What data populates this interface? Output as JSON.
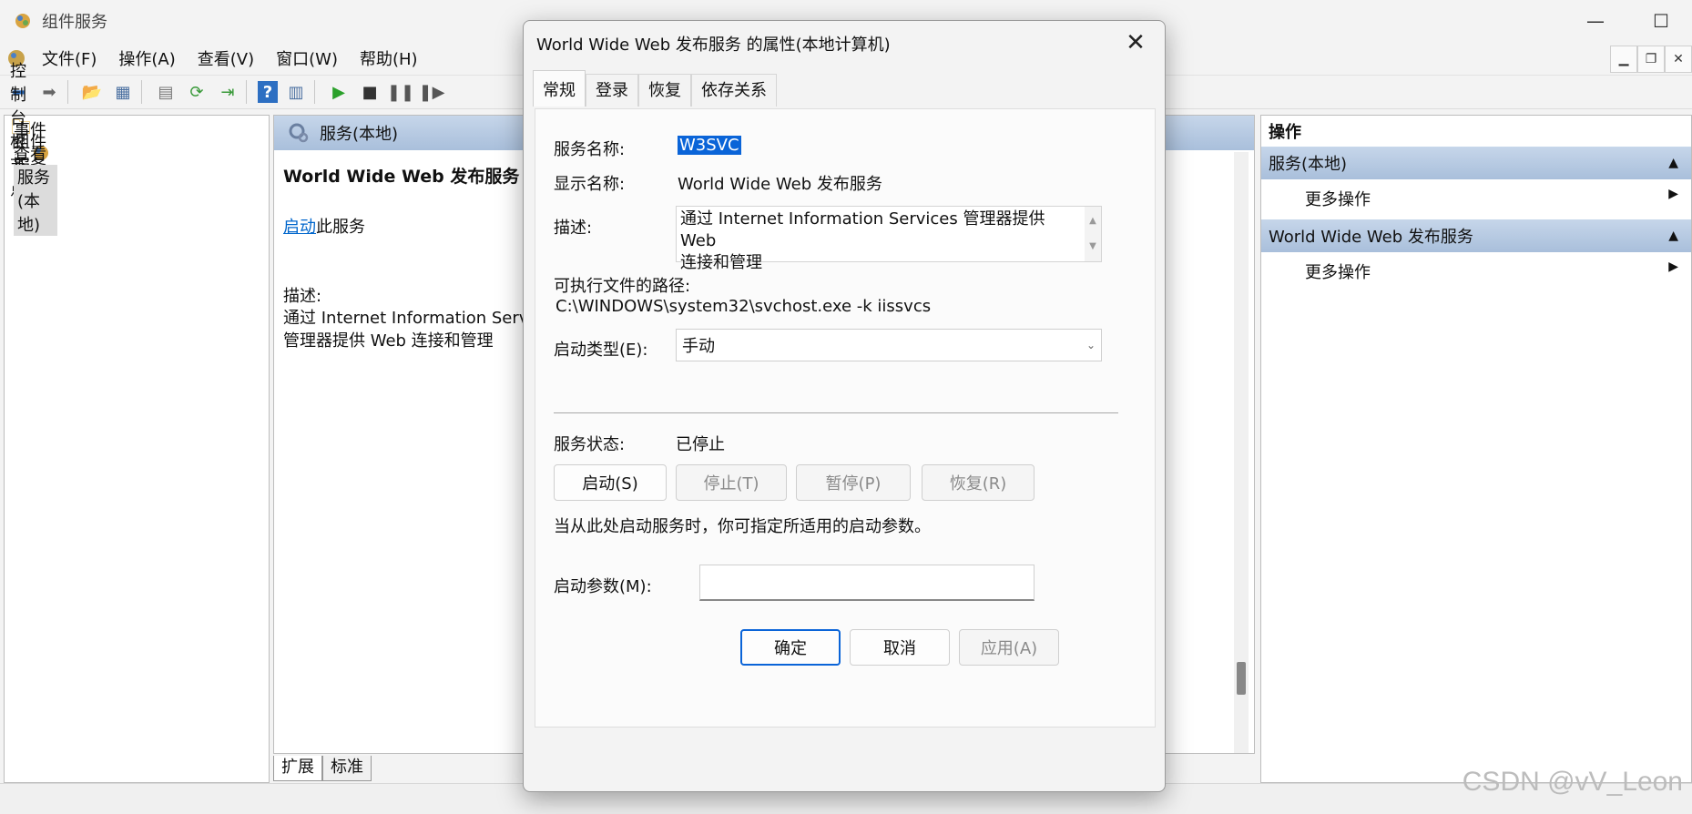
{
  "window": {
    "title": "组件服务",
    "controls": {
      "minimize": "—",
      "maximize": "☐",
      "close": "✕"
    }
  },
  "menu": {
    "items": [
      "文件(F)",
      "操作(A)",
      "查看(V)",
      "窗口(W)",
      "帮助(H)"
    ]
  },
  "tree": {
    "items": [
      {
        "label": "控制台根节点",
        "icon": "folder-icon"
      },
      {
        "label": "组件服务",
        "icon": "component-services-icon"
      },
      {
        "label": "事件查看器 (本地)",
        "icon": "event-viewer-icon"
      },
      {
        "label": "服务(本地)",
        "icon": "services-icon"
      }
    ]
  },
  "center": {
    "header": "服务(本地)",
    "service_name": "World Wide Web 发布服务",
    "start_link": "启动",
    "start_suffix": "此服务",
    "desc_label": "描述:",
    "desc_line1": "通过 Internet Information Servi",
    "desc_line2": "管理器提供 Web 连接和管理",
    "tabs": [
      "扩展",
      "标准"
    ]
  },
  "actions": {
    "title": "操作",
    "sections": [
      {
        "label": "服务(本地)",
        "item": "更多操作"
      },
      {
        "label": "World Wide Web 发布服务",
        "item": "更多操作"
      }
    ]
  },
  "dialog": {
    "title": "World Wide Web 发布服务 的属性(本地计算机)",
    "tabs": [
      "常规",
      "登录",
      "恢复",
      "依存关系"
    ],
    "service_name_label": "服务名称:",
    "service_name_value": "W3SVC",
    "display_name_label": "显示名称:",
    "display_name_value": "World Wide Web 发布服务",
    "description_label": "描述:",
    "description_line1": "通过 Internet Information Services 管理器提供 Web",
    "description_line2": "连接和管理",
    "exe_path_label": "可执行文件的路径:",
    "exe_path_value": "C:\\WINDOWS\\system32\\svchost.exe -k iissvcs",
    "startup_type_label": "启动类型(E):",
    "startup_type_value": "手动",
    "status_label": "服务状态:",
    "status_value": "已停止",
    "buttons": {
      "start": "启动(S)",
      "stop": "停止(T)",
      "pause": "暂停(P)",
      "resume": "恢复(R)"
    },
    "hint": "当从此处启动服务时，你可指定所适用的启动参数。",
    "params_label": "启动参数(M):",
    "params_value": "",
    "footer": {
      "ok": "确定",
      "cancel": "取消",
      "apply": "应用(A)"
    }
  },
  "watermark": "CSDN @vV_Leon",
  "colors": {
    "accent": "#0a64d8",
    "header_gradient": "#b5c9e2",
    "link": "#0066cc"
  }
}
